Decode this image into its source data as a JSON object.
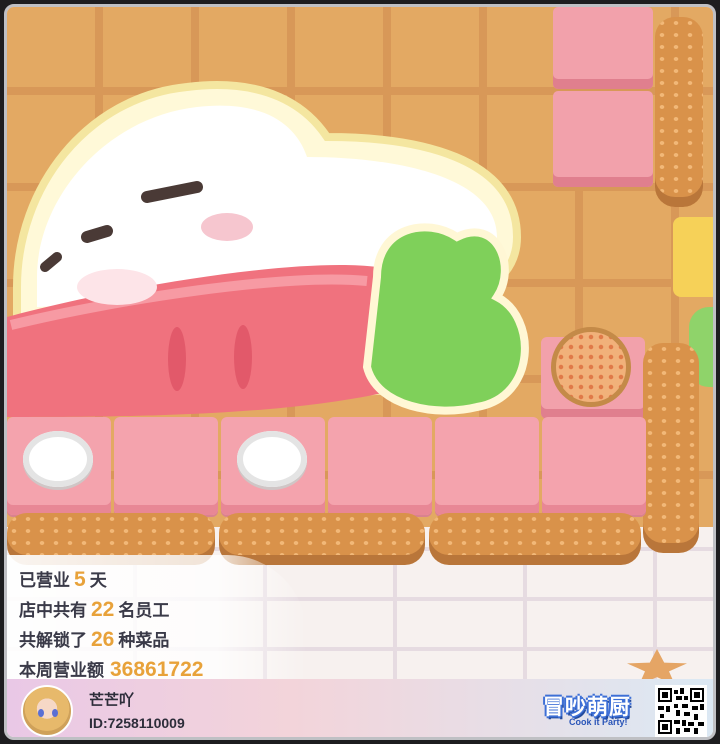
{
  "stats": {
    "days_prefix": "已营业",
    "days_value": "5",
    "days_suffix": "天",
    "staff_prefix": "店中共有",
    "staff_value": "22",
    "staff_suffix": "名员工",
    "dishes_prefix": "共解锁了",
    "dishes_value": "26",
    "dishes_suffix": "种菜品",
    "weekly_label": "本周营业额",
    "weekly_value": "36861722"
  },
  "footer": {
    "username": "芒芒吖",
    "user_id": "ID:7258110009",
    "logo_title": "冒吵萌厨",
    "logo_subtitle": "Cook it Party!"
  },
  "colors": {
    "highlight": "#e8a23a",
    "counter_pink": "#f4a3ad",
    "carrot": "#f0727e",
    "leaf": "#7fd05a"
  }
}
